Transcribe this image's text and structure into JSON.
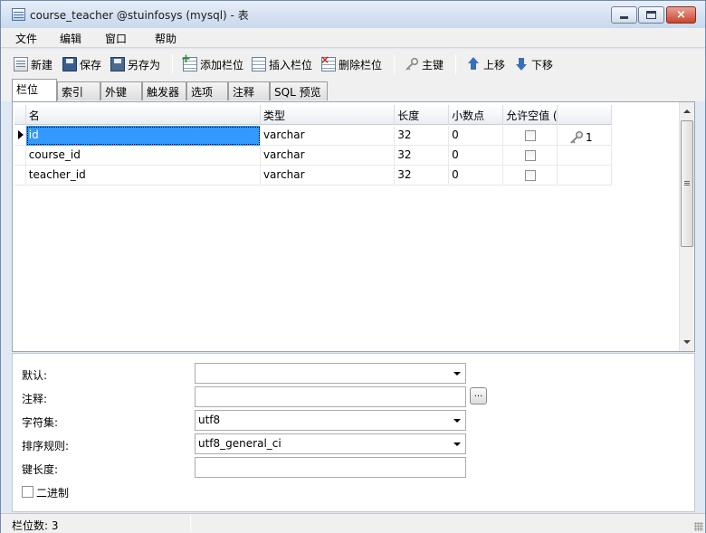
{
  "window": {
    "title": "course_teacher @stuinfosys (mysql) - 表",
    "close_glyph": "×"
  },
  "menu": [
    "文件",
    "编辑",
    "窗口",
    "帮助"
  ],
  "toolbar": {
    "new": "新建",
    "save": "保存",
    "save_as": "另存为",
    "add_field": "添加栏位",
    "insert_field": "插入栏位",
    "delete_field": "删除栏位",
    "primary_key": "主键",
    "move_up": "上移",
    "move_down": "下移"
  },
  "tabs": [
    "栏位",
    "索引",
    "外键",
    "触发器",
    "选项",
    "注释",
    "SQL 预览"
  ],
  "active_tab": "栏位",
  "grid": {
    "headers": [
      "名",
      "类型",
      "长度",
      "小数点",
      "允许空值 (",
      ""
    ],
    "rows": [
      {
        "name": "id",
        "type": "varchar",
        "length": "32",
        "decimals": "0",
        "allow_null": false,
        "key": "1",
        "selected": true
      },
      {
        "name": "course_id",
        "type": "varchar",
        "length": "32",
        "decimals": "0",
        "allow_null": false,
        "key": ""
      },
      {
        "name": "teacher_id",
        "type": "varchar",
        "length": "32",
        "decimals": "0",
        "allow_null": false,
        "key": ""
      }
    ]
  },
  "properties": {
    "default_label": "默认:",
    "default_value": "",
    "comment_label": "注释:",
    "comment_value": "",
    "comment_button": "...",
    "charset_label": "字符集:",
    "charset_value": "utf8",
    "collation_label": "排序规则:",
    "collation_value": "utf8_general_ci",
    "key_length_label": "键长度:",
    "key_length_value": "",
    "binary_label": "二进制",
    "binary_checked": false
  },
  "status": {
    "field_count": "栏位数: 3"
  },
  "colors": {
    "selection": "#3399ff",
    "window_frame": "#dfe8f3",
    "close_button": "#c9452d"
  },
  "icons": [
    "new-table-icon",
    "save-icon",
    "save-as-icon",
    "add-field-icon",
    "insert-field-icon",
    "delete-field-icon",
    "key-icon",
    "arrow-up-icon",
    "arrow-down-icon"
  ]
}
